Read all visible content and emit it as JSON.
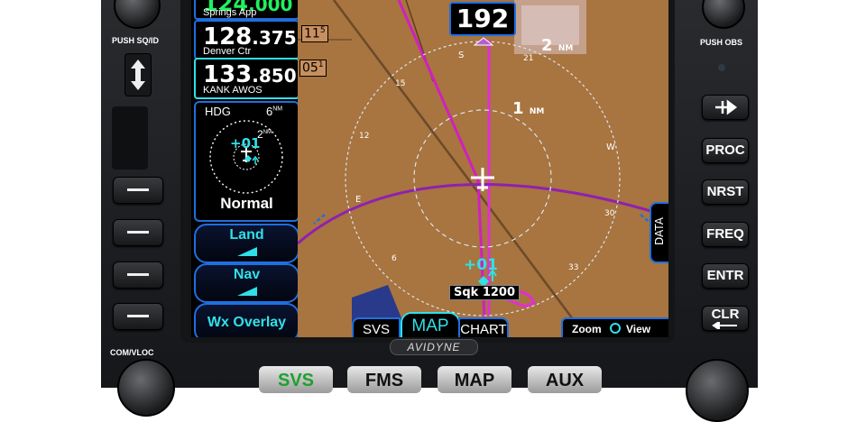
{
  "hardware": {
    "push_sq_id": "PUSH SQ/ID",
    "push_obs": "PUSH OBS",
    "com_vloc": "COM/VLOC",
    "right_keys": [
      "PROC",
      "NRST",
      "FREQ",
      "ENTR",
      "CLR"
    ],
    "bottom_keys": [
      "SVS",
      "FMS",
      "MAP",
      "AUX"
    ],
    "brand": "AVIDYNE"
  },
  "radios": [
    {
      "freq_main": "124",
      "freq_sub": ".000",
      "label": "Springs App"
    },
    {
      "freq_main": "128",
      "freq_sub": ".375",
      "label": "Denver Ctr"
    },
    {
      "freq_main": "133",
      "freq_sub": ".850",
      "label": "KANK AWOS"
    }
  ],
  "mini_map": {
    "mode": "HDG",
    "range_outer": "6",
    "range_outer_unit": "NM",
    "range_inner": "2",
    "range_inner_unit": "NM",
    "target": "+01",
    "label": "Normal"
  },
  "line_keys": [
    {
      "label": "Land"
    },
    {
      "label": "Nav"
    },
    {
      "label": "Wx Overlay"
    }
  ],
  "map": {
    "heading": "192",
    "range_outer": "2",
    "range_inner": "1",
    "unit": "NM",
    "traffic_alt": "+01",
    "squawk": "Sqk 1200",
    "alt_tag_1": "11",
    "alt_tag_1_sup": "5",
    "alt_tag_2": "05",
    "alt_tag_2_sup": "1",
    "data_tab": "DATA",
    "tabs": [
      "SVS",
      "MAP",
      "CHART"
    ],
    "zoom_label": "Zoom",
    "view_label": "View",
    "compass": [
      "S",
      "21",
      "W",
      "30",
      "33",
      "6",
      "E",
      "12",
      "15"
    ]
  },
  "colors": {
    "cyan": "#30e0e8",
    "magenta": "#e020c8",
    "accent_blue": "#1f6fe0",
    "terrain": "#a8743f"
  }
}
